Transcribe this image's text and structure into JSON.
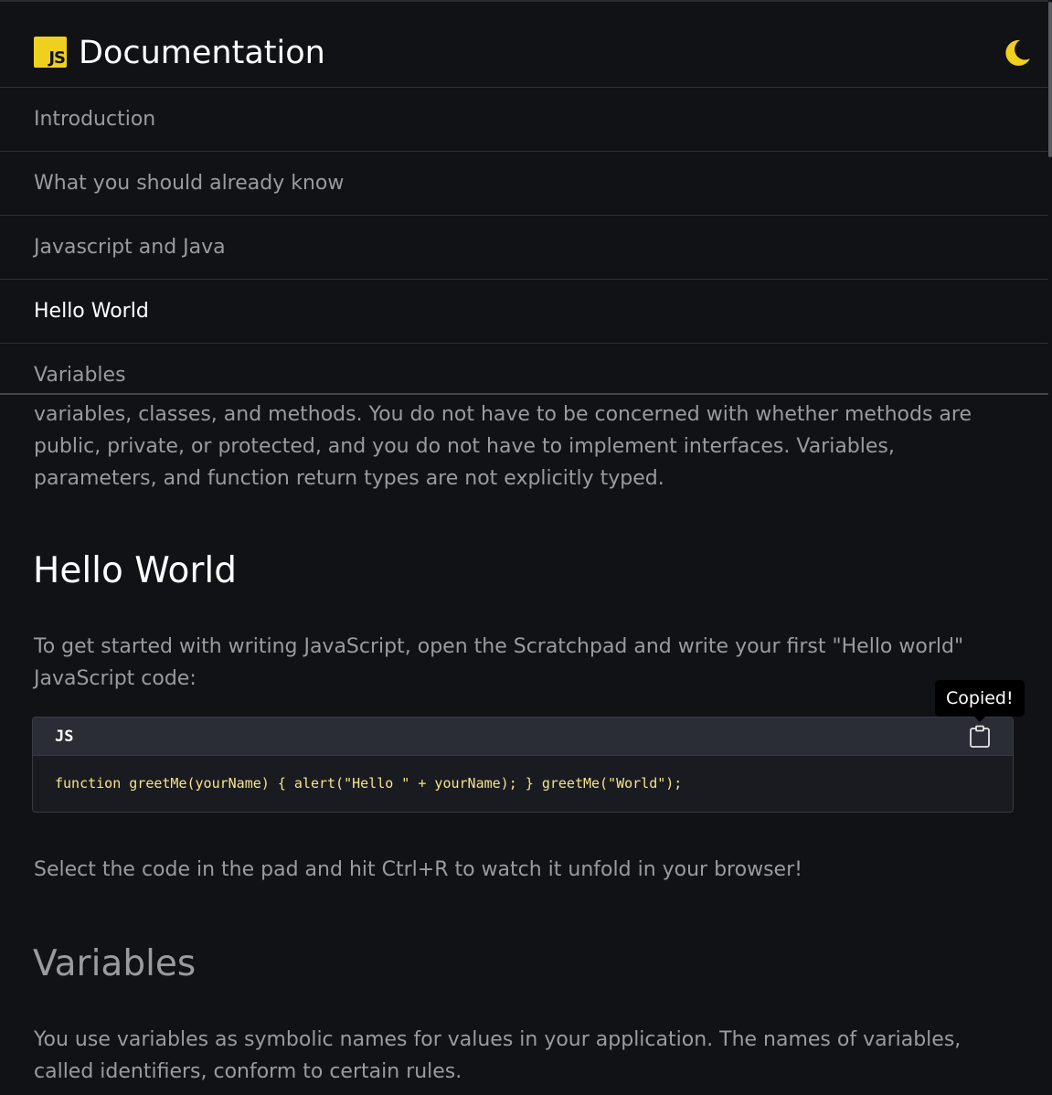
{
  "header": {
    "logo_text": "JS",
    "title": "Documentation",
    "theme_toggle_icon": "moon-icon"
  },
  "nav": {
    "items": [
      {
        "label": "Introduction",
        "active": false
      },
      {
        "label": "What you should already know",
        "active": false
      },
      {
        "label": "Javascript and Java",
        "active": false
      },
      {
        "label": "Hello World",
        "active": true
      },
      {
        "label": "Variables",
        "active": false
      }
    ]
  },
  "content": {
    "intro_tail": "variables, classes, and methods. You do not have to be concerned with whether methods are public, private, or protected, and you do not have to implement interfaces. Variables, parameters, and function return types are not explicitly typed.",
    "hello_heading": "Hello World",
    "hello_para": "To get started with writing JavaScript, open the Scratchpad and write your first \"Hello world\" JavaScript code:",
    "code": {
      "lang": "JS",
      "text": "function greetMe(yourName) { alert(\"Hello \" + yourName); } greetMe(\"World\");",
      "copy_icon": "clipboard-icon",
      "tooltip": "Copied!"
    },
    "select_para": "Select the code in the pad and hit Ctrl+R to watch it unfold in your browser!",
    "variables_heading": "Variables",
    "variables_para": "You use variables as symbolic names for values in your application. The names of variables, called identifiers, conform to certain rules."
  },
  "colors": {
    "background": "#111216",
    "accent_yellow": "#f0d01e",
    "text_muted": "#9a9ba1",
    "text_bright": "#ffffff",
    "code_text": "#f4e58a"
  }
}
